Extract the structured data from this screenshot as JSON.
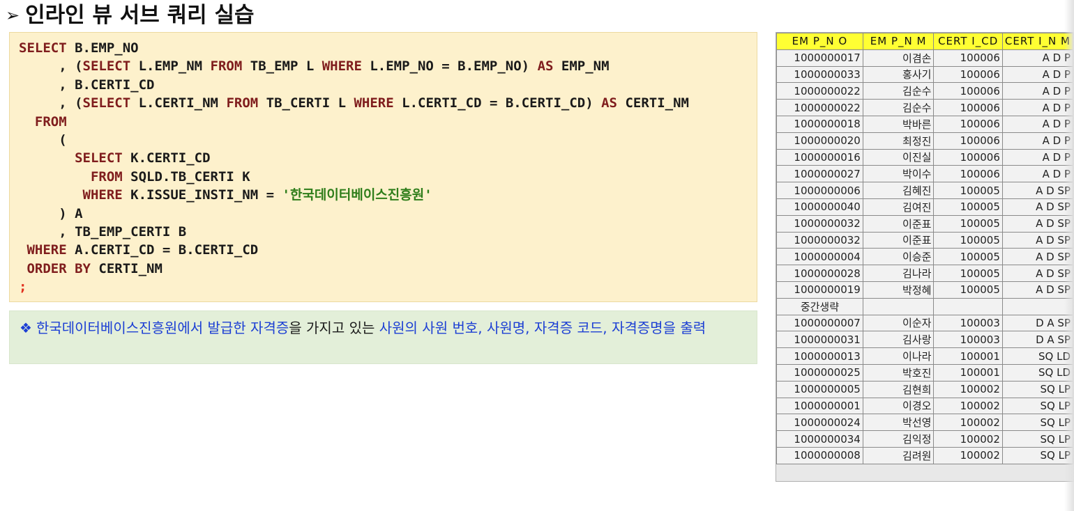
{
  "title": {
    "arrow": "➢",
    "text": "인라인 뷰 서브 쿼리 실습"
  },
  "code": {
    "line1": {
      "k1": "SELECT",
      "t1": " B.EMP_NO"
    },
    "line2": {
      "t1": "     , (",
      "k1": "SELECT",
      "t2": " L.EMP_NM ",
      "k2": "FROM",
      "t3": " TB_EMP L ",
      "k3": "WHERE",
      "t4": " L.EMP_NO = B.EMP_NO) ",
      "k4": "AS",
      "t5": " EMP_NM"
    },
    "line3": {
      "t1": "     , B.CERTI_CD"
    },
    "line4": {
      "t1": "     , (",
      "k1": "SELECT",
      "t2": " L.CERTI_NM ",
      "k2": "FROM",
      "t3": " TB_CERTI L ",
      "k3": "WHERE",
      "t4": " L.CERTI_CD = B.CERTI_CD) ",
      "k4": "AS",
      "t5": " CERTI_NM"
    },
    "line5": {
      "t1": "  ",
      "k1": "FROM"
    },
    "line6": {
      "t1": "     ("
    },
    "line7": {
      "t1": "       ",
      "k1": "SELECT",
      "t2": " K.CERTI_CD"
    },
    "line8": {
      "t1": "         ",
      "k1": "FROM",
      "t2": " SQLD.TB_CERTI K"
    },
    "line9": {
      "t1": "        ",
      "k1": "WHERE",
      "t2": " K.ISSUE_INSTI_NM = ",
      "s1": "'한국데이터베이스진흥원'"
    },
    "line10": {
      "t1": "     ) A"
    },
    "line11": {
      "t1": "     , TB_EMP_CERTI B"
    },
    "line12": {
      "t1": " ",
      "k1": "WHERE",
      "t2": " A.CERTI_CD = B.CERTI_CD"
    },
    "line13": {
      "t1": " ",
      "k1": "ORDER BY",
      "t2": " CERTI_NM"
    },
    "line14": {
      "s1": ";"
    }
  },
  "note": {
    "bullet": "❖",
    "part1": "한국데이터베이스진흥원에서 발급한 자격증",
    "part2": "을 가지고 있는 ",
    "part3": "사원의 사원 번호, 사원명, 자격증 코드, 자격증명을 출력"
  },
  "result_table": {
    "headers": [
      "EM P_N O",
      "EM P_N M",
      "CERT I_CD",
      "CERT I_N M"
    ],
    "rows": [
      [
        "1000000017",
        "이겸손",
        "100006",
        "A D P"
      ],
      [
        "1000000033",
        "홍사기",
        "100006",
        "A D P"
      ],
      [
        "1000000022",
        "김순수",
        "100006",
        "A D P"
      ],
      [
        "1000000022",
        "김순수",
        "100006",
        "A D P"
      ],
      [
        "1000000018",
        "박바른",
        "100006",
        "A D P"
      ],
      [
        "1000000020",
        "최정진",
        "100006",
        "A D P"
      ],
      [
        "1000000016",
        "이진실",
        "100006",
        "A D P"
      ],
      [
        "1000000027",
        "박이수",
        "100006",
        "A D P"
      ],
      [
        "1000000006",
        "김혜진",
        "100005",
        "A D SP"
      ],
      [
        "1000000040",
        "김여진",
        "100005",
        "A D SP"
      ],
      [
        "1000000032",
        "이준표",
        "100005",
        "A D SP"
      ],
      [
        "1000000032",
        "이준표",
        "100005",
        "A D SP"
      ],
      [
        "1000000004",
        "이승준",
        "100005",
        "A D SP"
      ],
      [
        "1000000028",
        "김나라",
        "100005",
        "A D SP"
      ],
      [
        "1000000019",
        "박정혜",
        "100005",
        "A D SP"
      ],
      [
        "중간생략",
        "",
        "",
        ""
      ],
      [
        "1000000007",
        "이순자",
        "100003",
        "D A SP"
      ],
      [
        "1000000031",
        "김사랑",
        "100003",
        "D A SP"
      ],
      [
        "1000000013",
        "이나라",
        "100001",
        "SQ LD"
      ],
      [
        "1000000025",
        "박호진",
        "100001",
        "SQ LD"
      ],
      [
        "1000000005",
        "김현희",
        "100002",
        "SQ LP"
      ],
      [
        "1000000001",
        "이경오",
        "100002",
        "SQ LP"
      ],
      [
        "1000000024",
        "박선영",
        "100002",
        "SQ LP"
      ],
      [
        "1000000034",
        "김익정",
        "100002",
        "SQ LP"
      ],
      [
        "1000000008",
        "김려원",
        "100002",
        "SQ LP"
      ]
    ]
  }
}
